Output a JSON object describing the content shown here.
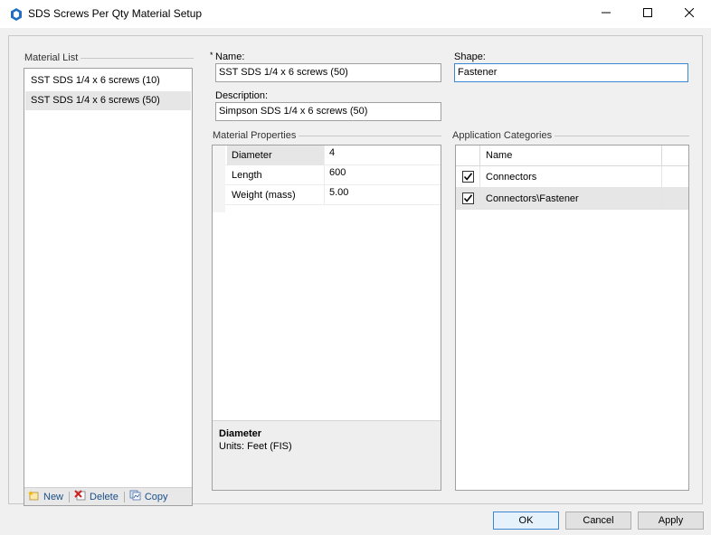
{
  "window": {
    "title": "SDS Screws Per Qty Material Setup"
  },
  "material_list": {
    "label": "Material List",
    "items": [
      {
        "label": "SST SDS 1/4 x 6 screws (10)",
        "selected": false
      },
      {
        "label": "SST SDS 1/4 x 6 screws (50)",
        "selected": true
      }
    ],
    "toolbar": {
      "new_label": "New",
      "delete_label": "Delete",
      "copy_label": "Copy"
    }
  },
  "form": {
    "name_required_marker": "*",
    "name_label": "Name:",
    "name_value": "SST SDS 1/4 x 6 screws (50)",
    "description_label": "Description:",
    "description_value": "Simpson SDS 1/4 x 6 screws (50)",
    "shape_label": "Shape:",
    "shape_value": "Fastener"
  },
  "material_properties": {
    "label": "Material Properties",
    "rows": [
      {
        "name": "Diameter",
        "value": "4",
        "selected": true
      },
      {
        "name": "Length",
        "value": "600",
        "selected": false
      },
      {
        "name": "Weight (mass)",
        "value": "5.00",
        "selected": false
      }
    ],
    "help": {
      "title": "Diameter",
      "text": "Units: Feet (FIS)"
    }
  },
  "application_categories": {
    "label": "Application Categories",
    "column_name": "Name",
    "rows": [
      {
        "name": "Connectors",
        "checked": true,
        "selected": false
      },
      {
        "name": "Connectors\\Fastener",
        "checked": true,
        "selected": true
      }
    ]
  },
  "buttons": {
    "ok": "OK",
    "cancel": "Cancel",
    "apply": "Apply"
  },
  "colors": {
    "accent": "#3a87d6",
    "selection": "#e6e6e6",
    "dialog_bg": "#f0f0f0"
  }
}
